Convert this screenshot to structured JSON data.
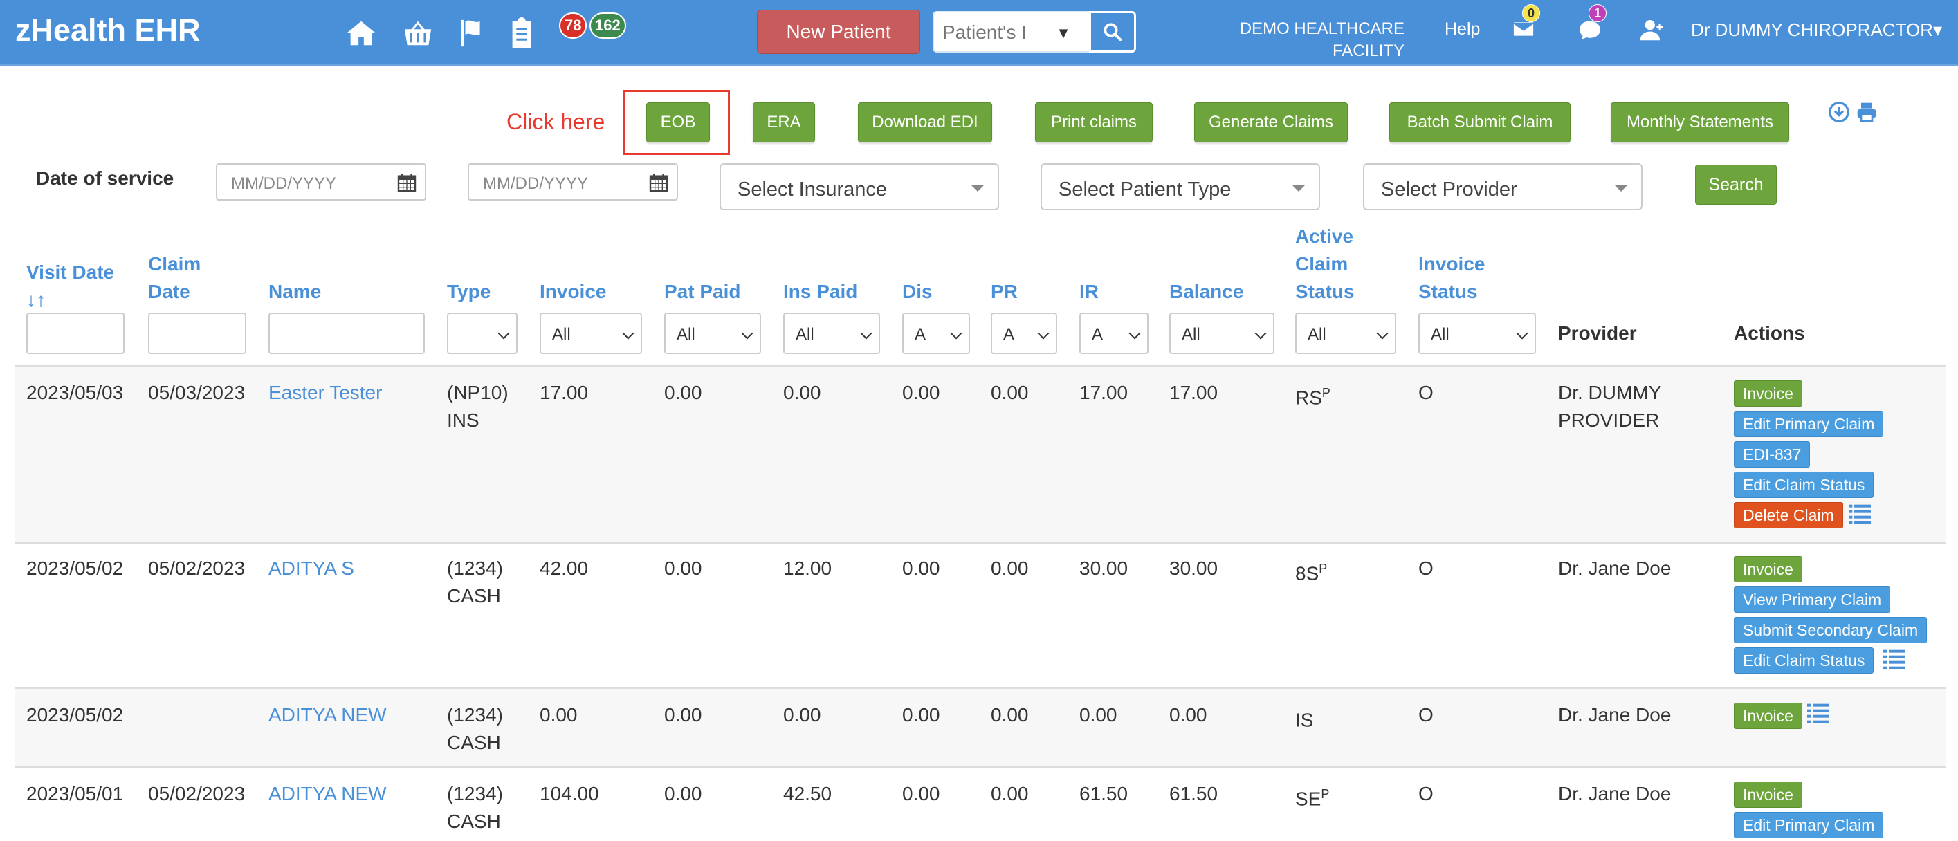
{
  "app": {
    "brand": "zHealth EHR",
    "badges": {
      "red": "78",
      "green": "162"
    },
    "new_patient": "New Patient",
    "search_placeholder": "Patient's I",
    "facility_line1": "DEMO HEALTHCARE",
    "facility_line2": "FACILITY",
    "help": "Help",
    "mail_count": "0",
    "chat_count": "1",
    "user_name": "Dr DUMMY CHIROPRACTOR",
    "user_caret": "▾"
  },
  "toolbar": {
    "annotation": "Click here",
    "buttons": [
      "EOB",
      "ERA",
      "Download EDI",
      "Print claims",
      "Generate Claims",
      "Batch Submit Claim",
      "Monthly Statements"
    ]
  },
  "filters": {
    "date_label": "Date of service",
    "date_from_placeholder": "MM/DD/YYYY",
    "date_to_placeholder": "MM/DD/YYYY",
    "insurance": "Select Insurance",
    "patient_type": "Select Patient Type",
    "provider": "Select Provider",
    "search": "Search"
  },
  "table": {
    "headers": {
      "visit_date": "Visit Date",
      "visit_sort": "↓↑",
      "claim_date_1": "Claim",
      "claim_date_2": "Date",
      "name": "Name",
      "type": "Type",
      "invoice": "Invoice",
      "pat_paid": "Pat Paid",
      "ins_paid": "Ins Paid",
      "dis": "Dis",
      "pr": "PR",
      "ir": "IR",
      "balance": "Balance",
      "acs_1": "Active",
      "acs_2": "Claim",
      "acs_3": "Status",
      "is_1": "Invoice",
      "is_2": "Status",
      "provider": "Provider",
      "actions": "Actions"
    },
    "filter_values": {
      "invoice": "All",
      "pat_paid": "All",
      "ins_paid": "All",
      "dis": "A",
      "pr": "A",
      "ir": "A",
      "balance": "All",
      "acs": "All",
      "is": "All"
    },
    "rows": [
      {
        "visit_date": "2023/05/03",
        "claim_date": "05/03/2023",
        "name": "Easter Tester",
        "type1": "(NP10)",
        "type2": "INS",
        "invoice": "17.00",
        "pat_paid": "0.00",
        "ins_paid": "0.00",
        "dis": "0.00",
        "pr": "0.00",
        "ir": "17.00",
        "balance": "17.00",
        "acs": "RS",
        "acs_sup": "P",
        "inv_status": "O",
        "provider1": "Dr. DUMMY",
        "provider2": "PROVIDER",
        "actions": [
          "Invoice",
          "Edit Primary Claim",
          "EDI-837",
          "Edit Claim Status",
          "Delete Claim"
        ]
      },
      {
        "visit_date": "2023/05/02",
        "claim_date": "05/02/2023",
        "name": "ADITYA S",
        "type1": "(1234)",
        "type2": "CASH",
        "invoice": "42.00",
        "pat_paid": "0.00",
        "ins_paid": "12.00",
        "dis": "0.00",
        "pr": "0.00",
        "ir": "30.00",
        "balance": "30.00",
        "acs": "8S",
        "acs_sup": "P",
        "inv_status": "O",
        "provider1": "Dr. Jane Doe",
        "provider2": "",
        "actions": [
          "Invoice",
          "View Primary Claim",
          "Submit Secondary Claim",
          "Edit Claim Status"
        ]
      },
      {
        "visit_date": "2023/05/02",
        "claim_date": "",
        "name": "ADITYA NEW",
        "type1": "(1234)",
        "type2": "CASH",
        "invoice": "0.00",
        "pat_paid": "0.00",
        "ins_paid": "0.00",
        "dis": "0.00",
        "pr": "0.00",
        "ir": "0.00",
        "balance": "0.00",
        "acs": "IS",
        "acs_sup": "",
        "inv_status": "O",
        "provider1": "Dr. Jane Doe",
        "provider2": "",
        "actions": [
          "Invoice"
        ]
      },
      {
        "visit_date": "2023/05/01",
        "claim_date": "05/02/2023",
        "name": "ADITYA NEW",
        "type1": "(1234)",
        "type2": "CASH",
        "invoice": "104.00",
        "pat_paid": "0.00",
        "ins_paid": "42.50",
        "dis": "0.00",
        "pr": "0.00",
        "ir": "61.50",
        "balance": "61.50",
        "acs": "SE",
        "acs_sup": "P",
        "inv_status": "O",
        "provider1": "Dr. Jane Doe",
        "provider2": "",
        "actions": [
          "Invoice",
          "Edit Primary Claim"
        ]
      }
    ]
  }
}
